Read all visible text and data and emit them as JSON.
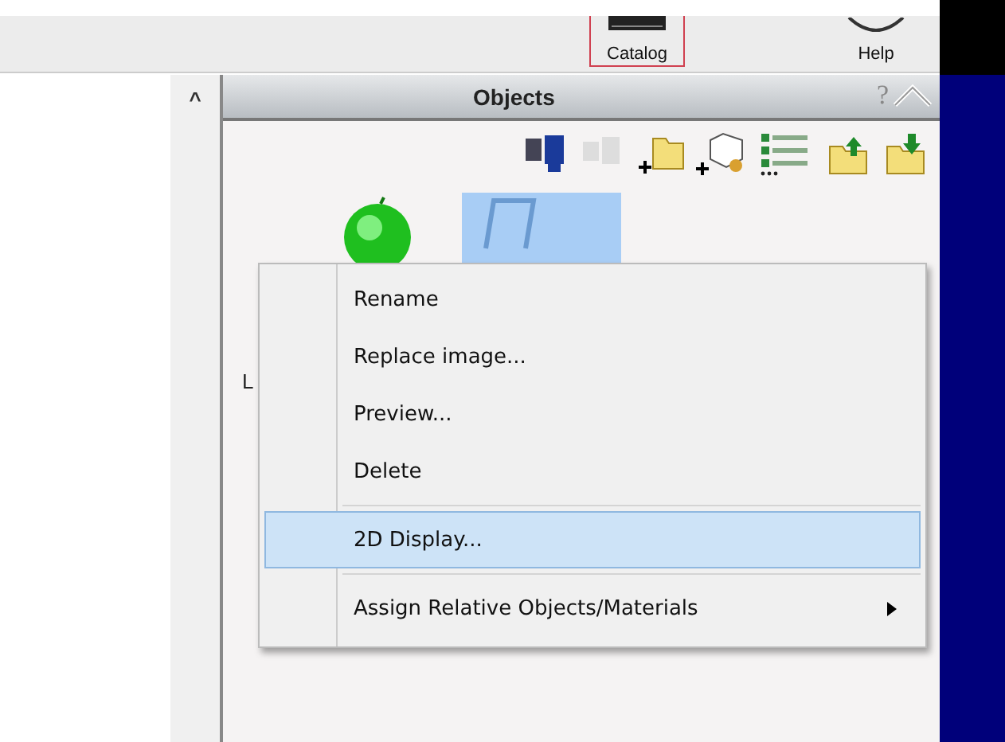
{
  "toolbar": {
    "buttons": [
      {
        "label": "Catalog",
        "selected": true
      },
      {
        "label": "Help",
        "selected": false
      }
    ]
  },
  "side_column": {
    "collapse": "^"
  },
  "panel": {
    "title": "Objects",
    "help": "?",
    "item_label": "L"
  },
  "context_menu": {
    "items": [
      {
        "kind": "item",
        "label": "Rename",
        "selected": false,
        "submenu": false
      },
      {
        "kind": "item",
        "label": "Replace image...",
        "selected": false,
        "submenu": false
      },
      {
        "kind": "item",
        "label": "Preview...",
        "selected": false,
        "submenu": false
      },
      {
        "kind": "item",
        "label": "Delete",
        "selected": false,
        "submenu": false
      },
      {
        "kind": "separator"
      },
      {
        "kind": "item",
        "label": "2D Display...",
        "selected": true,
        "submenu": false
      },
      {
        "kind": "separator"
      },
      {
        "kind": "item",
        "label": "Assign Relative Objects/Materials",
        "selected": false,
        "submenu": true
      }
    ]
  }
}
